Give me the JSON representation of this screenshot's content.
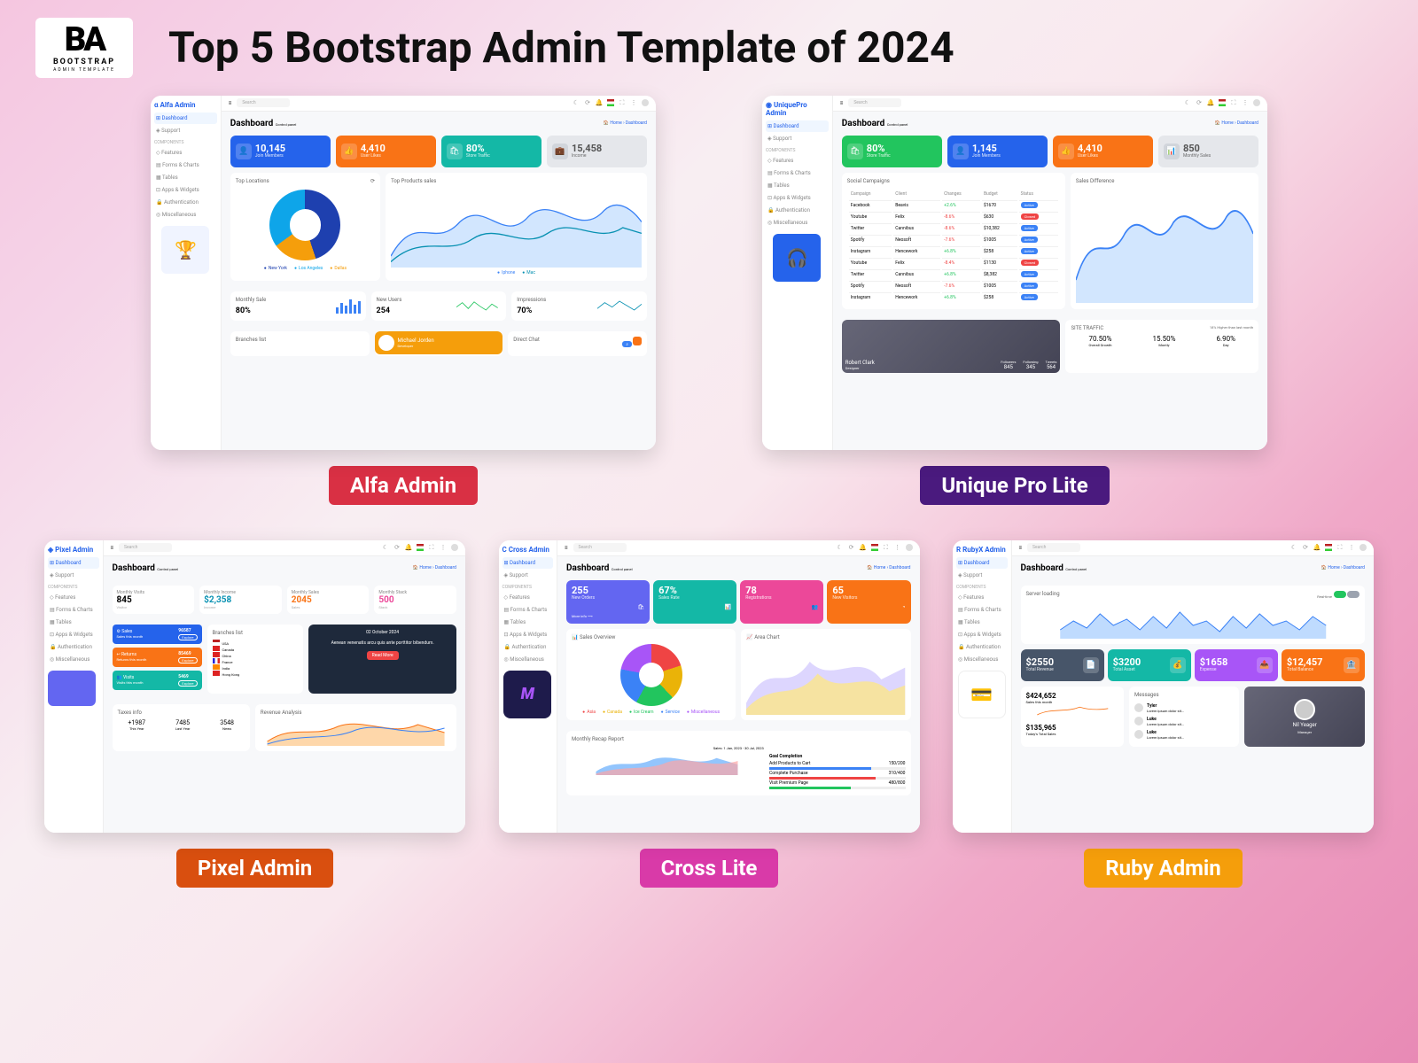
{
  "header": {
    "logo_main": "BA",
    "logo_text": "BOOTSTRAP",
    "logo_sub": "ADMIN TEMPLATE",
    "title": "Top 5 Bootstrap Admin Template of 2024"
  },
  "badges": {
    "alfa": "Alfa  Admin",
    "unique": "Unique Pro Lite",
    "pixel": "Pixel Admin",
    "cross": "Cross Lite",
    "ruby": "Ruby Admin"
  },
  "common": {
    "search": "Search",
    "dashboard_label": "Dashboard",
    "control": "Control panel",
    "breadcrumb": "🏠 Home  ›  Dashboard",
    "sidebar": {
      "dashboard": "Dashboard",
      "support": "Support",
      "components": "Components",
      "features": "Features",
      "forms": "Forms & Charts",
      "tables": "Tables",
      "apps": "Apps & Widgets",
      "auth": "Authentication",
      "misc": "Miscellaneous"
    }
  },
  "alfa": {
    "brand": "Alfa Admin",
    "cards": [
      {
        "v": "10,145",
        "l": "Join Members"
      },
      {
        "v": "4,410",
        "l": "User Likes"
      },
      {
        "v": "80%",
        "l": "Store Traffic"
      },
      {
        "v": "15,458",
        "l": "Income"
      }
    ],
    "panels": {
      "loc": "Top Locations",
      "prod": "Top Products sales"
    },
    "legend": {
      "a": "New York",
      "b": "Los Angeles",
      "c": "Dallas",
      "s1": "Iphone",
      "s2": "Mac"
    },
    "stats": [
      {
        "t": "Monthly Sale",
        "v": "80%"
      },
      {
        "t": "New Users",
        "v": "254"
      },
      {
        "t": "Impressions",
        "v": "70%"
      }
    ],
    "branches": "Branches list",
    "profile": {
      "name": "Michael Jorden",
      "role": "Developer"
    },
    "chat": "Direct Chat"
  },
  "unique": {
    "brand": "UniquePro Admin",
    "cards": [
      {
        "v": "80%",
        "l": "Store Traffic"
      },
      {
        "v": "1,145",
        "l": "Join Members"
      },
      {
        "v": "4,410",
        "l": "User Likes"
      },
      {
        "v": "850",
        "l": "Monthly Sales"
      }
    ],
    "social": "Social Campaigns",
    "diff": "Sales Difference",
    "cols": [
      "Campaign",
      "Client",
      "Changes",
      "Budget",
      "Status"
    ],
    "rows": [
      [
        "Facebook",
        "Beavis",
        "+2.6%",
        "$1670",
        "Active"
      ],
      [
        "Youtube",
        "Felix",
        "-8.6%",
        "$630",
        "Closed"
      ],
      [
        "Twitter",
        "Cannibus",
        "-8.6%",
        "$10,382",
        "Active"
      ],
      [
        "Spotify",
        "Neosoft",
        "-7.6%",
        "$1005",
        "Active"
      ],
      [
        "Instagram",
        "Hencework",
        "+6.8%",
        "$258",
        "Active"
      ],
      [
        "Youtube",
        "Felix",
        "-8.4%",
        "$1130",
        "Closed"
      ],
      [
        "Twitter",
        "Cannibus",
        "+6.8%",
        "$8,382",
        "Active"
      ],
      [
        "Spotify",
        "Neosoft",
        "-7.6%",
        "$1005",
        "Active"
      ],
      [
        "Instagram",
        "Hencework",
        "+6.8%",
        "$258",
        "Active"
      ]
    ],
    "traffic": {
      "title": "SITE TRAFFIC",
      "sub": "18% Higher than last month",
      "a": {
        "v": "70.50%",
        "l": "Overall Growth"
      },
      "b": {
        "v": "15.50%",
        "l": "Montly"
      },
      "c": {
        "v": "6.90%",
        "l": "Day"
      }
    },
    "profile": {
      "name": "Robert Clark",
      "role": "Designer",
      "followers": "Followers",
      "following": "Following",
      "tweets": "Tweets",
      "fv": "845",
      "fg": "345",
      "tv": "564"
    }
  },
  "pixel": {
    "brand": "Pixel Admin",
    "stats": [
      {
        "t": "Monthly Visits",
        "v": "845",
        "s": "Visitor"
      },
      {
        "t": "Monthly Income",
        "v": "$2,358",
        "s": "Income"
      },
      {
        "t": "Monthly Sales",
        "v": "2045",
        "s": "Sales"
      },
      {
        "t": "Monthly Stack",
        "v": "500",
        "s": "Stack"
      }
    ],
    "side": [
      {
        "t": "Sales",
        "v": "96587",
        "s": "Sales this month"
      },
      {
        "t": "Returns",
        "v": "85469",
        "s": "Returns this month"
      },
      {
        "t": "Visits",
        "v": "5469",
        "s": "Visits this month"
      }
    ],
    "btn": "Explore",
    "branches": "Branches list",
    "countries": [
      "USA",
      "Canada",
      "China",
      "France",
      "India",
      "Hong Kong"
    ],
    "dark": {
      "date": "02 October 2024",
      "text": "Aenean venenatis arcu quis ante porttitor bibendum.",
      "btn": "Read More"
    },
    "taxes": {
      "title": "Taxes info",
      "a": "+1987",
      "al": "This Year",
      "b": "7485",
      "bl": "Last Year",
      "c": "3548",
      "cl": "News"
    },
    "rev": "Revenue Analysis"
  },
  "cross": {
    "brand": "Cross Admin",
    "cards": [
      {
        "v": "255",
        "l": "New Orders",
        "more": "More info ⟶"
      },
      {
        "v": "67%",
        "l": "Sales Rate"
      },
      {
        "v": "78",
        "l": "Registrations"
      },
      {
        "v": "65",
        "l": "New Visitors"
      }
    ],
    "overview": "Sales Overview",
    "area": "Area Chart",
    "legend": [
      "Asia",
      "Canada",
      "Ice Cream",
      "Service",
      "Miscellaneous"
    ],
    "recap": "Monthly Recap Report",
    "recap_sub": "Sales: 1 Jan, 2023 - 30 Jul, 2023",
    "goal": "Goal Completion",
    "goals": [
      {
        "t": "Add Products to Cart",
        "v": "150/200"
      },
      {
        "t": "Complete Purchase",
        "v": "310/400"
      },
      {
        "t": "Visit Premium Page",
        "v": "480/800"
      }
    ]
  },
  "ruby": {
    "brand": "RubyX Admin",
    "server": "Server loading",
    "rt": "Real-time",
    "stats": [
      {
        "v": "$2550",
        "l": "Total Revenue"
      },
      {
        "v": "$3200",
        "l": "Total Asset"
      },
      {
        "v": "$1658",
        "l": "Expense"
      },
      {
        "v": "$12,457",
        "l": "Total Balance"
      }
    ],
    "bal1": {
      "v": "$424,652",
      "l": "Sales this month"
    },
    "bal2": {
      "v": "$135,965",
      "l": "Today's Total Sales"
    },
    "msg": {
      "title": "Messages",
      "users": [
        "Tyler",
        "Luke",
        "Luke"
      ]
    },
    "prof": {
      "name": "Nil Yeager",
      "role": "Manager"
    }
  }
}
